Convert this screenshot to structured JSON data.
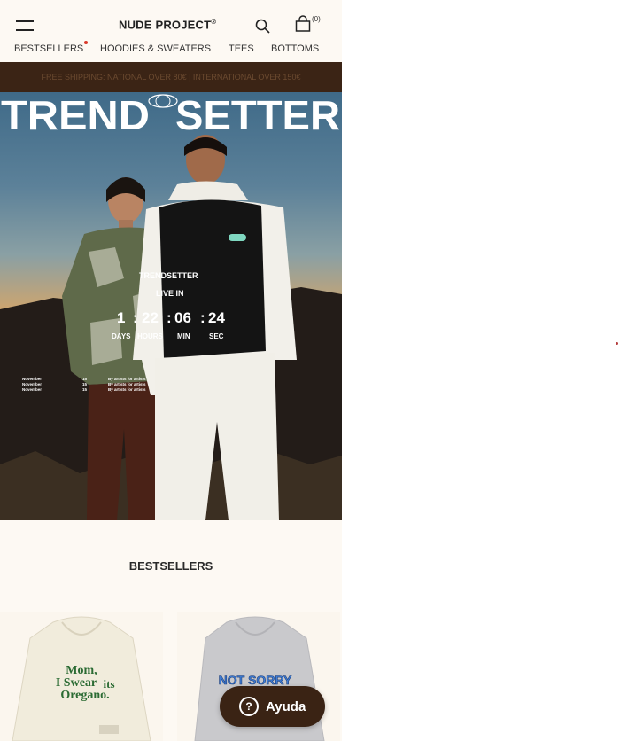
{
  "header": {
    "logo_text": "NUDE PROJECT",
    "logo_mark": "®",
    "cart_count": "(0)"
  },
  "nav": {
    "items": [
      {
        "label": "BESTSELLERS"
      },
      {
        "label": "HOODIES & SWEATERS"
      },
      {
        "label": "TEES"
      },
      {
        "label": "BOTTOMS"
      }
    ]
  },
  "banner": {
    "text": "FREE SHIPPING: NATIONAL OVER 80€ | INTERNATIONAL OVER 150€"
  },
  "hero": {
    "title_left": "TREND",
    "title_right": "SETTER",
    "countdown_title": "TRENDSETTER",
    "countdown_subtitle": "LIVE IN",
    "days": "1",
    "hours": "22",
    "minutes": "06",
    "seconds": "24",
    "days_label": "DAYS",
    "hours_label": "HOURS",
    "minutes_label": "MIN",
    "seconds_label": "SEC",
    "schedule": [
      {
        "month": "November",
        "day": "15",
        "text": "By artists for artists"
      },
      {
        "month": "November",
        "day": "15",
        "text": "By artists for artists"
      },
      {
        "month": "November",
        "day": "15",
        "text": "By artists for artists"
      }
    ]
  },
  "bestsellers": {
    "title": "BESTSELLERS",
    "products": [
      {
        "print_line1": "Mom,",
        "print_line2": "I Swear",
        "print_line3": "its",
        "print_line4": "Oregano.",
        "color": "#f1ecdc"
      },
      {
        "print_line1": "NOT SORRY",
        "color": "#c9c9cc"
      }
    ]
  },
  "help": {
    "label": "Ayuda"
  }
}
